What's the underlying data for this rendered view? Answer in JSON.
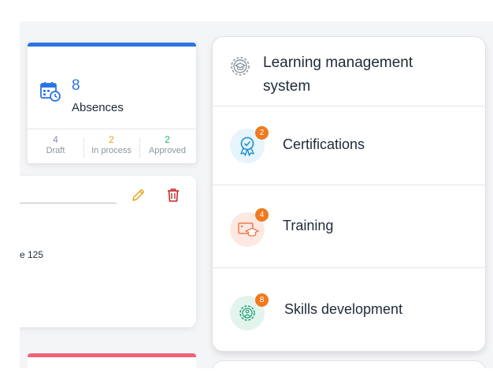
{
  "absences": {
    "count": "8",
    "label": "Absences",
    "stats": [
      {
        "value": "4",
        "label": "Draft",
        "color": "#8b95a1"
      },
      {
        "value": "2",
        "label": "In process",
        "color": "#e8a31a"
      },
      {
        "value": "2",
        "label": "Approved",
        "color": "#22b573"
      }
    ],
    "accent": "#2b74e2",
    "icon": "calendar-clock-icon"
  },
  "edit_card": {
    "partial_text": "e 125",
    "icons": [
      "pencil-icon",
      "trash-icon"
    ],
    "pencil_color": "#e8a31a",
    "trash_color": "#c62828"
  },
  "pink_card": {
    "accent": "#f0627a"
  },
  "lms": {
    "title": "Learning management system",
    "icon": "gear-graduation-icon",
    "items": [
      {
        "label": "Certifications",
        "badge": "2",
        "icon": "award-ribbon-icon",
        "color": "#1a8fd1",
        "bg": "#e6f4fb"
      },
      {
        "label": "Training",
        "badge": "4",
        "icon": "training-board-icon",
        "color": "#f07a4a",
        "bg": "#fde9e1"
      },
      {
        "label": "Skills development",
        "badge": "8",
        "icon": "skills-gear-icon",
        "color": "#2aa37a",
        "bg": "#e3f4ed"
      }
    ],
    "badge_color": "#f07a1e"
  }
}
